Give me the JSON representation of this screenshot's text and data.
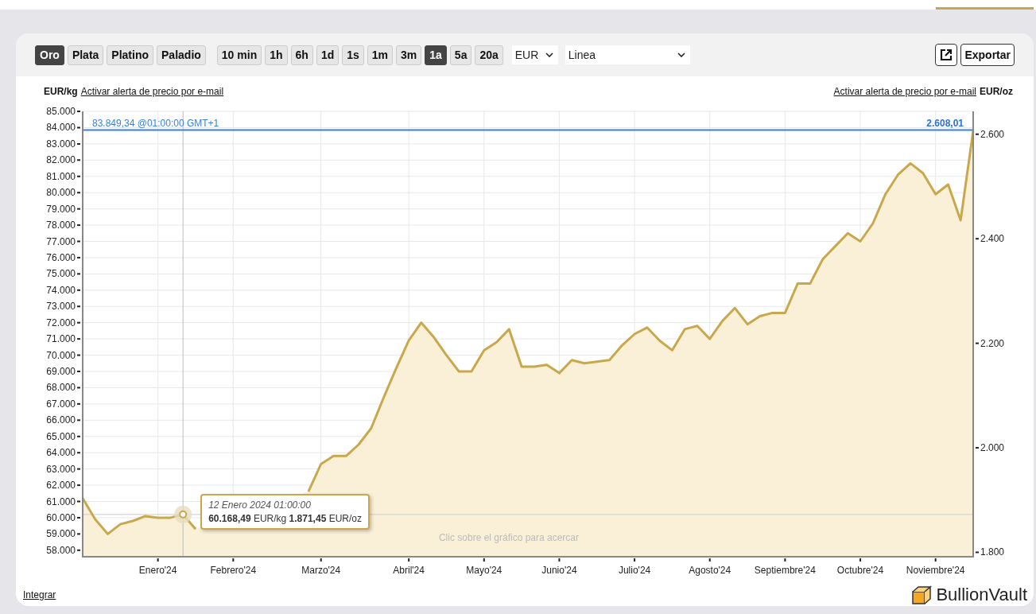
{
  "toolbar": {
    "metals": [
      {
        "label": "Oro",
        "selected": true
      },
      {
        "label": "Plata",
        "selected": false
      },
      {
        "label": "Platino",
        "selected": false
      },
      {
        "label": "Paladio",
        "selected": false
      }
    ],
    "periods": [
      {
        "label": "10 min",
        "selected": false
      },
      {
        "label": "1h",
        "selected": false
      },
      {
        "label": "6h",
        "selected": false
      },
      {
        "label": "1d",
        "selected": false
      },
      {
        "label": "1s",
        "selected": false
      },
      {
        "label": "1m",
        "selected": false
      },
      {
        "label": "3m",
        "selected": false
      },
      {
        "label": "1a",
        "selected": true
      },
      {
        "label": "5a",
        "selected": false
      },
      {
        "label": "20a",
        "selected": false
      }
    ],
    "currency": "EUR",
    "chart_style": "Linea",
    "export_label": "Exportar"
  },
  "header": {
    "left_unit": "EUR/kg",
    "left_link": "Activar alerta de precio por e-mail",
    "right_link": "Activar alerta de precio por e-mail",
    "right_unit": "EUR/oz"
  },
  "chart": {
    "hint": "Clic sobre el gráfico para acercar",
    "price_line": {
      "oz_label": "2.608,01"
    },
    "tooltip": {
      "date": "12 Enero 2024 01:00:00",
      "values": "**60.168,49** EUR/kg **1.871,45** EUR/oz"
    },
    "right_axis_labels": [
      "2.600",
      "2.400",
      "2.200",
      "2.000",
      "1.800"
    ],
    "chart_data": {
      "type": "area",
      "ylim": [
        57600,
        85000
      ],
      "grid": true,
      "ref_lines": [
        {
          "axis": "y",
          "value": 83849.34,
          "label": "83.849,34 @01:00:00 GMT+1",
          "color": "#3a80e0"
        },
        {
          "axis": "y",
          "value": 60200,
          "color": "#cccccc"
        }
      ],
      "categories": [
        null,
        null,
        null,
        null,
        null,
        null,
        "Enero'24",
        null,
        null,
        null,
        null,
        null,
        "Febrero'24",
        null,
        null,
        null,
        null,
        null,
        null,
        "Marzo'24",
        null,
        null,
        null,
        null,
        null,
        null,
        "Abril'24",
        null,
        null,
        null,
        null,
        null,
        "Mayo'24",
        null,
        null,
        null,
        null,
        null,
        "Junio'24",
        null,
        null,
        null,
        null,
        null,
        "Julio'24",
        null,
        null,
        null,
        null,
        null,
        "Agosto'24",
        null,
        null,
        null,
        null,
        null,
        "Septiembre'24",
        null,
        null,
        null,
        null,
        null,
        "Octubre'24",
        null,
        null,
        null,
        null,
        null,
        "Noviembre'24",
        null,
        null,
        null
      ],
      "yticks": [
        {
          "value": 85000,
          "label": "85.000"
        },
        {
          "value": 84000,
          "label": "84.000"
        },
        {
          "value": 83000,
          "label": "83.000"
        },
        {
          "value": 82000,
          "label": "82.000"
        },
        {
          "value": 81000,
          "label": "81.000"
        },
        {
          "value": 80000,
          "label": "80.000"
        },
        {
          "value": 79000,
          "label": "79.000"
        },
        {
          "value": 78000,
          "label": "78.000"
        },
        {
          "value": 77000,
          "label": "77.000"
        },
        {
          "value": 76000,
          "label": "76.000"
        },
        {
          "value": 75000,
          "label": "75.000"
        },
        {
          "value": 74000,
          "label": "74.000"
        },
        {
          "value": 73000,
          "label": "73.000"
        },
        {
          "value": 72000,
          "label": "72.000"
        },
        {
          "value": 71000,
          "label": "71.000"
        },
        {
          "value": 70000,
          "label": "70.000"
        },
        {
          "value": 69000,
          "label": "69.000"
        },
        {
          "value": 68000,
          "label": "68.000"
        },
        {
          "value": 67000,
          "label": "67.000"
        },
        {
          "value": 66000,
          "label": "66.000"
        },
        {
          "value": 65000,
          "label": "65.000"
        },
        {
          "value": 64000,
          "label": "64.000"
        },
        {
          "value": 63000,
          "label": "63.000"
        },
        {
          "value": 62000,
          "label": "62.000"
        },
        {
          "value": 61000,
          "label": "61.000"
        },
        {
          "value": 60000,
          "label": "60.000"
        },
        {
          "value": 59000,
          "label": "59.000"
        },
        {
          "value": 58000,
          "label": "58.000"
        }
      ],
      "series": [
        {
          "color": "#c8a84b",
          "values": [
            61200,
            59900,
            59000,
            59600,
            59800,
            60100,
            60000,
            60000,
            60200,
            59300,
            null,
            null,
            null,
            null,
            null,
            null,
            null,
            null,
            61600,
            63300,
            63800,
            63800,
            64500,
            65500,
            67400,
            69200,
            70900,
            72000,
            71100,
            70000,
            69000,
            69000,
            70300,
            70800,
            71600,
            69300,
            69300,
            69400,
            68900,
            69700,
            69500,
            69600,
            69700,
            70600,
            71300,
            71700,
            70900,
            70300,
            71600,
            71800,
            71000,
            72100,
            72900,
            71900,
            72400,
            72600,
            72600,
            74400,
            74400,
            75900,
            76700,
            77500,
            77000,
            78100,
            79900,
            81100,
            81800,
            81200,
            79900,
            80500,
            78300,
            83800
          ]
        }
      ]
    }
  },
  "footer": {
    "embed_link": "Integrar",
    "logo_text": "BullionVault"
  }
}
